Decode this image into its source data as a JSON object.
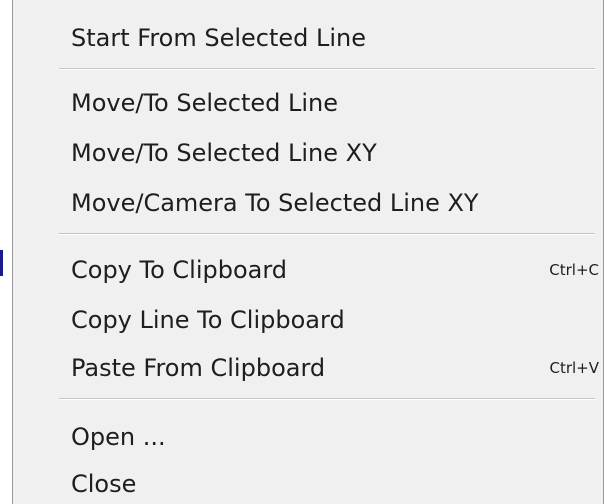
{
  "menu": {
    "items": [
      {
        "label": "Start From Selected Line",
        "shortcut": ""
      },
      {
        "label": "Move/To Selected Line",
        "shortcut": ""
      },
      {
        "label": "Move/To Selected Line XY",
        "shortcut": ""
      },
      {
        "label": "Move/Camera To Selected Line XY",
        "shortcut": ""
      },
      {
        "label": "Copy To Clipboard",
        "shortcut": "Ctrl+C"
      },
      {
        "label": "Copy Line To Clipboard",
        "shortcut": ""
      },
      {
        "label": "Paste From Clipboard",
        "shortcut": "Ctrl+V"
      },
      {
        "label": "Open ...",
        "shortcut": ""
      },
      {
        "label": "Close",
        "shortcut": ""
      }
    ]
  }
}
